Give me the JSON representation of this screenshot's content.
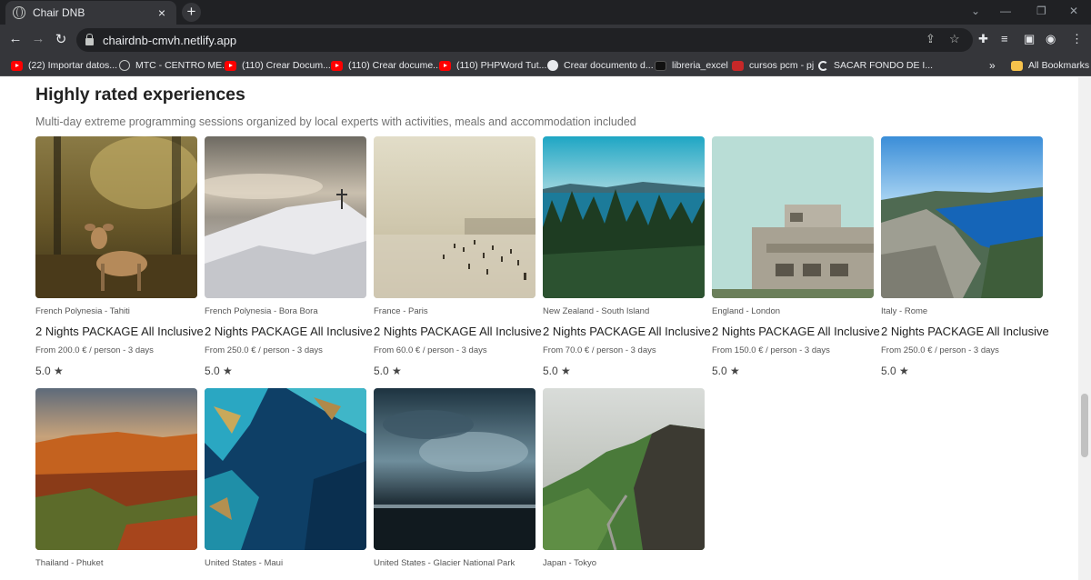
{
  "browser": {
    "tab_title": "Chair DNB",
    "tab_close": "×",
    "new_tab": "+",
    "url": "chairdnb-cmvh.netlify.app",
    "bookmarks": [
      {
        "label": "(22) Importar datos...",
        "icon": "youtube-icon"
      },
      {
        "label": "MTC - CENTRO ME...",
        "icon": "globe-icon"
      },
      {
        "label": "(110) Crear Docum...",
        "icon": "youtube-icon"
      },
      {
        "label": "(110) Crear docume...",
        "icon": "youtube-icon"
      },
      {
        "label": "(110) PHPWord Tut...",
        "icon": "youtube-icon"
      },
      {
        "label": "Crear documento d...",
        "icon": "wordpress-icon"
      },
      {
        "label": "libreria_excel",
        "icon": "github-icon"
      },
      {
        "label": "cursos pcm - pj",
        "icon": "pcm-icon"
      },
      {
        "label": "SACAR FONDO DE I...",
        "icon": "c-icon"
      }
    ],
    "bookmarks_overflow": "»",
    "all_bookmarks": "All Bookmarks"
  },
  "section": {
    "heading": "Highly rated experiences",
    "subheading": "Multi-day extreme programming sessions organized by local experts with activities, meals and accommodation included"
  },
  "experiences": [
    {
      "location": "French Polynesia - Tahiti",
      "title": "2 Nights PACKAGE All Inclusive",
      "price": "From 200.0 € / person - 3 days",
      "rating": "5.0 ★",
      "image": "deer-in-forest"
    },
    {
      "location": "French Polynesia - Bora Bora",
      "title": "2 Nights PACKAGE All Inclusive",
      "price": "From 250.0 € / person - 3 days",
      "rating": "5.0 ★",
      "image": "snowy-summit-cross"
    },
    {
      "location": "France - Paris",
      "title": "2 Nights PACKAGE All Inclusive",
      "price": "From 60.0 € / person - 3 days",
      "rating": "5.0 ★",
      "image": "hazy-beach-crowd"
    },
    {
      "location": "New Zealand - South Island",
      "title": "2 Nights PACKAGE All Inclusive",
      "price": "From 70.0 € / person - 3 days",
      "rating": "5.0 ★",
      "image": "pine-forest-lake"
    },
    {
      "location": "England - London",
      "title": "2 Nights PACKAGE All Inclusive",
      "price": "From 150.0 € / person - 3 days",
      "rating": "5.0 ★",
      "image": "concrete-bunker"
    },
    {
      "location": "Italy - Rome",
      "title": "2 Nights PACKAGE All Inclusive",
      "price": "From 250.0 € / person - 3 days",
      "rating": "5.0 ★",
      "image": "fjord-cliff"
    },
    {
      "location": "Thailand - Phuket",
      "image": "red-rock-canyon"
    },
    {
      "location": "United States - Maui",
      "image": "aerial-coastline"
    },
    {
      "location": "United States - Glacier National Park",
      "image": "stormy-sea"
    },
    {
      "location": "Japan - Tokyo",
      "image": "green-cliffs-road"
    }
  ]
}
